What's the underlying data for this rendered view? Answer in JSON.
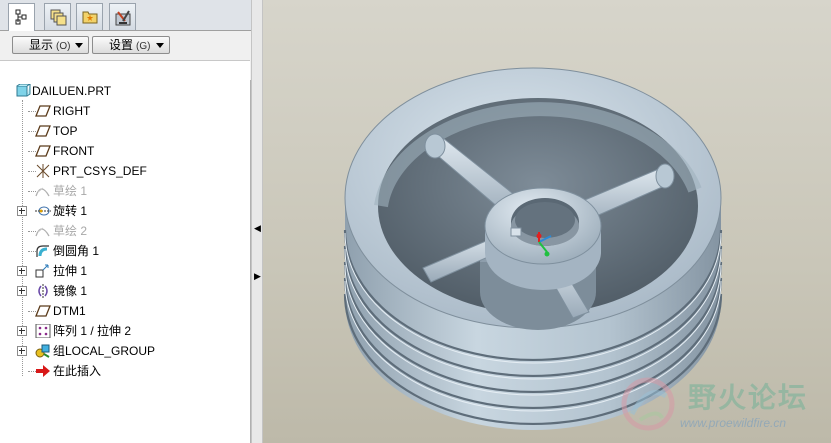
{
  "tabs": [
    {
      "name": "model-tree-icon",
      "active": true
    },
    {
      "name": "layers-icon",
      "active": false
    },
    {
      "name": "favorites-icon",
      "active": false
    },
    {
      "name": "tools-icon",
      "active": false
    }
  ],
  "toolbar": {
    "show_label": "显示",
    "show_shortcut": "(O)",
    "settings_label": "设置",
    "settings_shortcut": "(G)"
  },
  "tree": {
    "root": {
      "label": "DAILUEN.PRT",
      "icon": "part-icon"
    },
    "items": [
      {
        "label": "RIGHT",
        "icon": "datum-plane-icon",
        "expandable": false,
        "muted": false
      },
      {
        "label": "TOP",
        "icon": "datum-plane-icon",
        "expandable": false,
        "muted": false
      },
      {
        "label": "FRONT",
        "icon": "datum-plane-icon",
        "expandable": false,
        "muted": false
      },
      {
        "label": "PRT_CSYS_DEF",
        "icon": "coordinate-system-icon",
        "expandable": false,
        "muted": false
      },
      {
        "label": "草绘 1",
        "icon": "sketch-icon",
        "expandable": false,
        "muted": true
      },
      {
        "label": "旋转 1",
        "icon": "revolve-icon",
        "expandable": true,
        "muted": false
      },
      {
        "label": "草绘 2",
        "icon": "sketch-icon",
        "expandable": false,
        "muted": true
      },
      {
        "label": "倒圆角 1",
        "icon": "round-icon",
        "expandable": false,
        "muted": false
      },
      {
        "label": "拉伸 1",
        "icon": "extrude-icon",
        "expandable": true,
        "muted": false
      },
      {
        "label": "镜像 1",
        "icon": "mirror-icon",
        "expandable": true,
        "muted": false
      },
      {
        "label": "DTM1",
        "icon": "datum-plane-icon",
        "expandable": false,
        "muted": false
      },
      {
        "label": "阵列 1 / 拉伸 2",
        "icon": "pattern-icon",
        "expandable": true,
        "muted": false
      },
      {
        "label": "组LOCAL_GROUP",
        "icon": "group-icon",
        "expandable": true,
        "muted": false
      },
      {
        "label": "在此插入",
        "icon": "insert-here-arrow-icon",
        "expandable": false,
        "muted": false
      }
    ]
  },
  "viewport": {
    "model": "pulley-wheel",
    "colors": {
      "model": "#aebfcd",
      "background": "#cfccbf"
    }
  },
  "watermark": {
    "title": "野火论坛",
    "url": "www.proewildfire.cn"
  }
}
